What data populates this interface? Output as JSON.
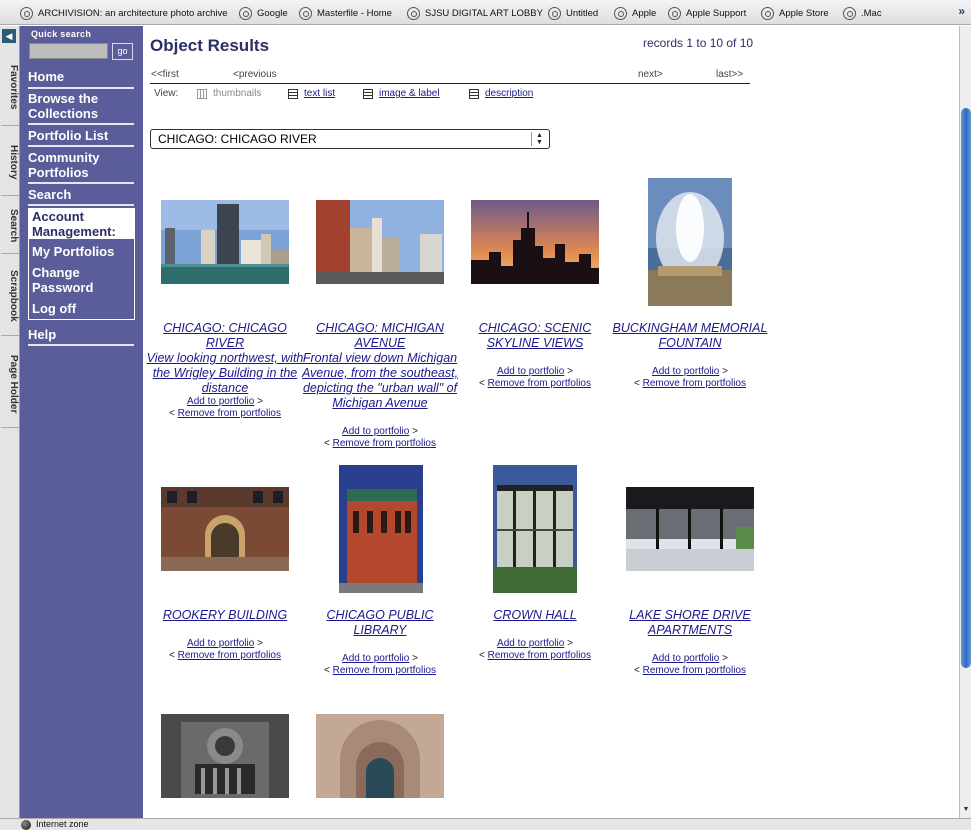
{
  "favorites": [
    {
      "label": "ARCHIVISION: an architecture photo archive"
    },
    {
      "label": "Google"
    },
    {
      "label": "Masterfile - Home"
    },
    {
      "label": "SJSU DIGITAL ART LOBBY"
    },
    {
      "label": "Untitled"
    },
    {
      "label": "Apple"
    },
    {
      "label": "Apple Support"
    },
    {
      "label": "Apple Store"
    },
    {
      "label": ".Mac"
    }
  ],
  "side_tabs": [
    "Favorites",
    "History",
    "Search",
    "Scrapbook",
    "Page Holder"
  ],
  "quick_search": {
    "label": "Quick search",
    "placeholder": "",
    "go_label": "go"
  },
  "nav": {
    "home": "Home",
    "browse": "Browse the Collections",
    "portfolio_list": "Portfolio List",
    "community": "Community Portfolios",
    "search": "Search",
    "account_head": "Account Management:",
    "my_portfolios": "My Portfolios",
    "change_password": "Change Password",
    "log_off": "Log off",
    "help": "Help"
  },
  "main": {
    "title": "Object Results",
    "records": "records 1 to 10 of 10",
    "pager": {
      "first": "<<first",
      "previous": "<previous",
      "next": "next>",
      "last": "last>>"
    },
    "view_label": "View:",
    "views": {
      "thumbnails": "thumbnails",
      "text_list": "text list",
      "image_label": "image & label",
      "description": "description"
    },
    "selected_object": "CHICAGO: CHICAGO RIVER"
  },
  "results": [
    {
      "title": "CHICAGO: CHICAGO RIVER",
      "caption": "View looking northwest, with the Wrigley Building in the distance"
    },
    {
      "title": "CHICAGO: MICHIGAN AVENUE",
      "caption": "Frontal view down Michigan Avenue, from the southeast, depicting the \"urban wall\" of Michigan Avenue"
    },
    {
      "title": "CHICAGO: SCENIC SKYLINE VIEWS",
      "caption": ""
    },
    {
      "title": "BUCKINGHAM MEMORIAL FOUNTAIN",
      "caption": ""
    },
    {
      "title": "ROOKERY BUILDING",
      "caption": ""
    },
    {
      "title": "CHICAGO PUBLIC LIBRARY",
      "caption": ""
    },
    {
      "title": "CROWN HALL",
      "caption": ""
    },
    {
      "title": "LAKE SHORE DRIVE APARTMENTS",
      "caption": ""
    },
    {
      "title": "",
      "caption": ""
    },
    {
      "title": "",
      "caption": ""
    }
  ],
  "actions": {
    "add": "Add to portfolio",
    "remove": "Remove from portfolios",
    "gt": ">",
    "lt": "<"
  },
  "status_bar": {
    "text": "Internet zone"
  }
}
